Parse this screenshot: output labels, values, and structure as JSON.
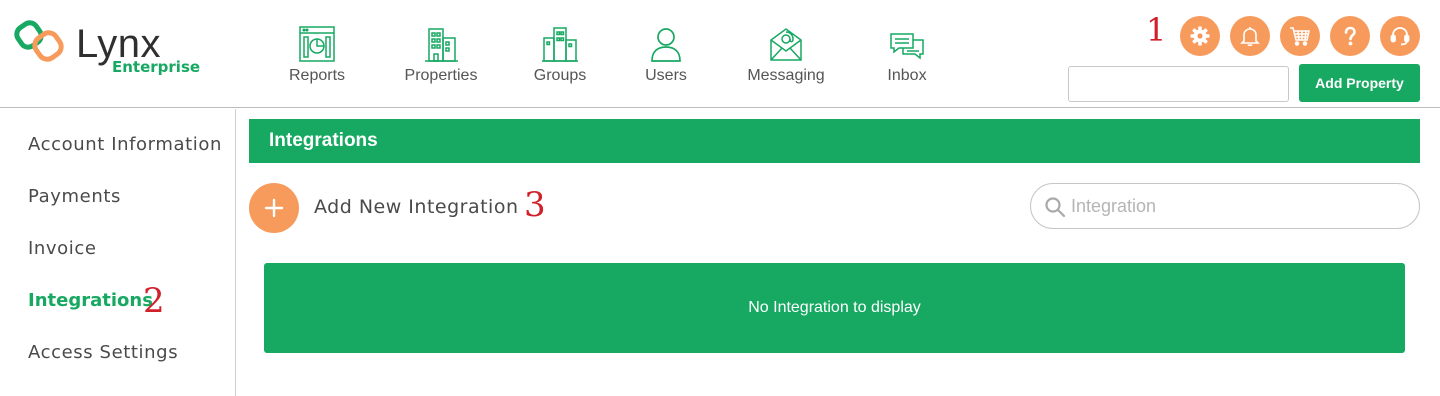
{
  "brand": {
    "name": "Lynx",
    "edition": "Enterprise",
    "colors": {
      "green": "#17a862",
      "orange": "#f79b5c",
      "annotation_red": "#d0212a"
    }
  },
  "nav": [
    {
      "label": "Reports",
      "icon": "reports-icon"
    },
    {
      "label": "Properties",
      "icon": "properties-icon"
    },
    {
      "label": "Groups",
      "icon": "groups-icon"
    },
    {
      "label": "Users",
      "icon": "users-icon"
    },
    {
      "label": "Messaging",
      "icon": "messaging-icon"
    },
    {
      "label": "Inbox",
      "icon": "inbox-icon"
    }
  ],
  "top_icons": [
    "gear-icon",
    "bell-icon",
    "cart-icon",
    "help-icon",
    "support-headset-icon"
  ],
  "annotations": {
    "one": "1",
    "two": "2",
    "three": "3"
  },
  "header": {
    "input_value": "",
    "add_property_label": "Add Property"
  },
  "sidebar": {
    "items": [
      {
        "label": "Account Information",
        "active": false
      },
      {
        "label": "Payments",
        "active": false
      },
      {
        "label": "Invoice",
        "active": false
      },
      {
        "label": "Integrations",
        "active": true
      },
      {
        "label": "Access Settings",
        "active": false
      }
    ]
  },
  "main": {
    "title": "Integrations",
    "add_label": "Add New Integration",
    "search_placeholder": "Integration",
    "empty_text": "No Integration to display"
  }
}
